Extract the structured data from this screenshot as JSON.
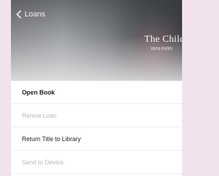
{
  "header": {
    "back_label": "Loans",
    "title": "The Child",
    "author": "Vera Kelm"
  },
  "menu": {
    "items": [
      {
        "label": "Open Book",
        "state": "bold"
      },
      {
        "label": "Renew Loan",
        "state": "disabled"
      },
      {
        "label": "Return Title to Library",
        "state": "normal"
      },
      {
        "label": "Send to Device",
        "state": "disabled"
      }
    ]
  },
  "colors": {
    "outer_background": "#f1e2ec",
    "panel_background": "#ffffff",
    "disabled_text": "#b9b9b9"
  }
}
